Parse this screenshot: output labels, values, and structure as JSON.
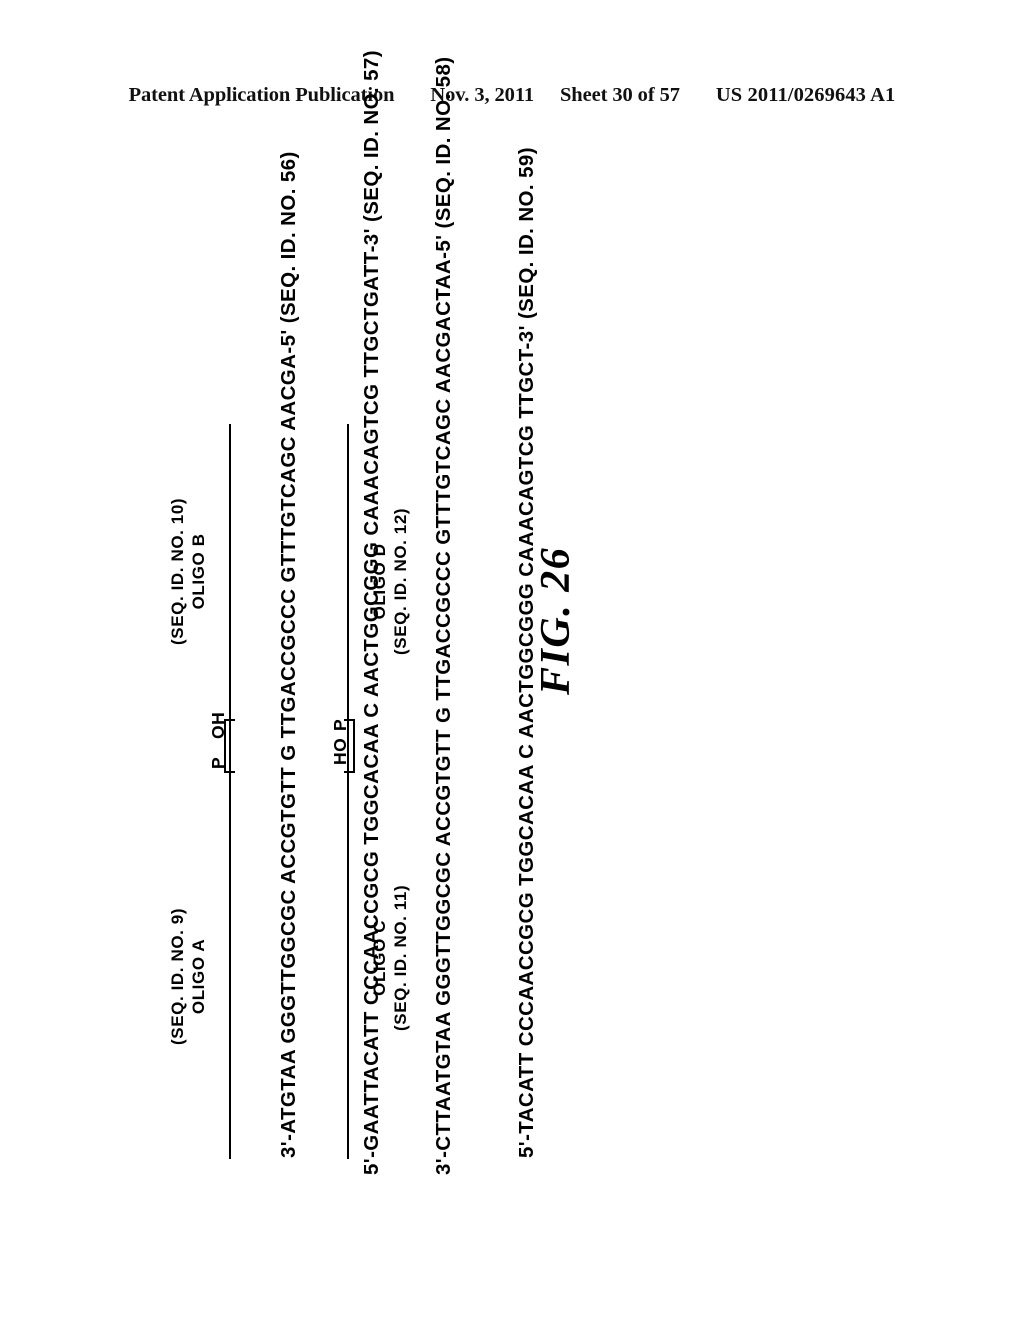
{
  "header": {
    "publication": "Patent Application Publication",
    "date": "Nov. 3, 2011",
    "sheet": "Sheet 30 of 57",
    "patent_number": "US 2011/0269643 A1"
  },
  "figure": {
    "caption": "FIG. 26",
    "sequences": [
      {
        "id": "row-1",
        "text": "3'-ATGTAA GGGTTGGCGC ACCGTGTT G TTGACCGCCC GTTTGTCAGC AACGA-5' (SEQ. ID. NO. 56)"
      },
      {
        "id": "row-2",
        "text": "5'-GAATTACATT CCCAACCGCG TGGCACAA C AACTGGCGGG CAAACAGTCG TTGCTGATT-3' (SEQ. ID. NO. 57)"
      },
      {
        "id": "row-3",
        "text": "3'-CTTAATGTAA GGGTTGGCGC ACCGTGTT G TTGACCGCCC GTTTGTCAGC AACGACTAA-5' (SEQ. ID. NO. 58)"
      },
      {
        "id": "row-4",
        "text": "5'-TACATT CCCAACCGCG TGGCACAA C AACTGGCGGG CAAACAGTCG TTGCT-3' (SEQ. ID. NO. 59)"
      }
    ],
    "callouts": {
      "oligo_a": {
        "seq_id": "(SEQ. ID. NO. 9)",
        "name": "OLIGO A"
      },
      "oligo_b": {
        "seq_id": "(SEQ. ID. NO. 10)",
        "name": "OLIGO B"
      },
      "oligo_c": {
        "name": "OLIGO C",
        "seq_id": "(SEQ. ID. NO. 11)"
      },
      "oligo_d": {
        "name": "OLIGO D",
        "seq_id": "(SEQ. ID. NO. 12)"
      }
    },
    "end_groups": {
      "top_left": "P",
      "top_right": "OH",
      "bottom_left": "HO",
      "bottom_right": "P"
    }
  }
}
